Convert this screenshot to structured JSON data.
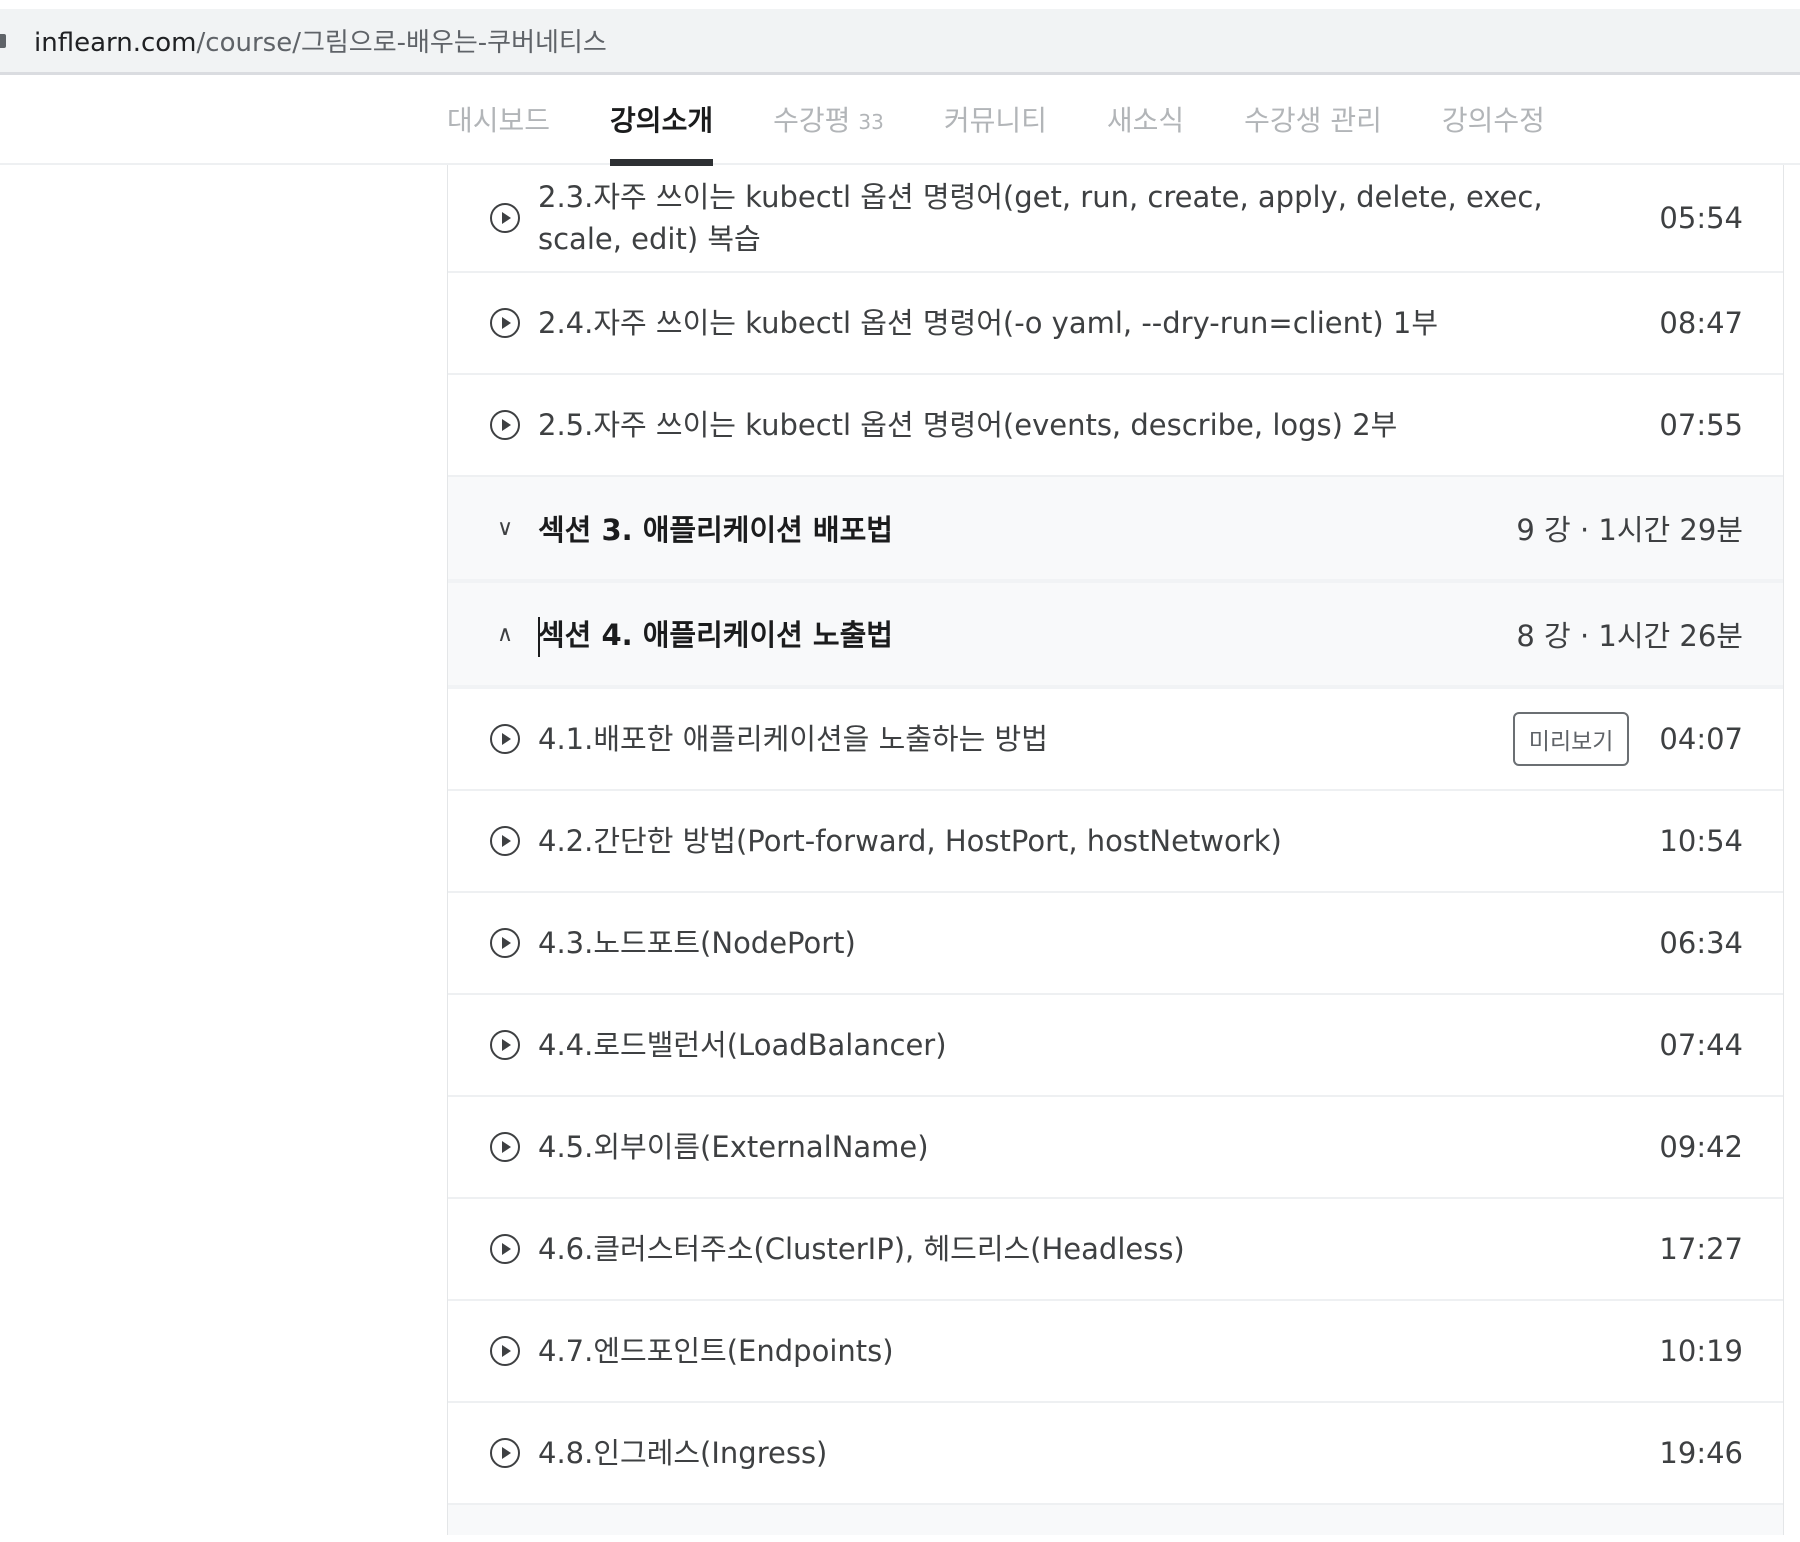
{
  "browser": {
    "url_host": "inflearn.com",
    "url_path": "/course/그림으로-배우는-쿠버네티스"
  },
  "tabs": [
    {
      "label": "대시보드"
    },
    {
      "label": "강의소개",
      "active": true
    },
    {
      "label": "수강평",
      "count": "33"
    },
    {
      "label": "커뮤니티"
    },
    {
      "label": "새소식"
    },
    {
      "label": "수강생 관리"
    },
    {
      "label": "강의수정"
    }
  ],
  "lessons_top": [
    {
      "title": "2.3.자주 쓰이는 kubectl 옵션 명령어(get, run, create, apply, delete, exec, scale, edit) 복습",
      "time": "05:54"
    },
    {
      "title": "2.4.자주 쓰이는 kubectl 옵션 명령어(-o yaml, --dry-run=client) 1부",
      "time": "08:47"
    },
    {
      "title": "2.5.자주 쓰이는 kubectl 옵션 명령어(events, describe, logs) 2부",
      "time": "07:55"
    }
  ],
  "sections": [
    {
      "title": "섹션 3. 애플리케이션 배포법",
      "meta": "9 강 · 1시간 29분",
      "expanded": false
    },
    {
      "title": "섹션 4. 애플리케이션 노출법",
      "meta": "8 강 · 1시간 26분",
      "expanded": true
    }
  ],
  "preview_label": "미리보기",
  "lessons_s4": [
    {
      "title": "4.1.배포한 애플리케이션을 노출하는 방법",
      "time": "04:07"
    },
    {
      "title": "4.2.간단한 방법(Port-forward, HostPort, hostNetwork)",
      "time": "10:54"
    },
    {
      "title": "4.3.노드포트(NodePort)",
      "time": "06:34"
    },
    {
      "title": "4.4.로드밸런서(LoadBalancer)",
      "time": "07:44"
    },
    {
      "title": "4.5.외부이름(ExternalName)",
      "time": "09:42"
    },
    {
      "title": "4.6.클러스터주소(ClusterIP), 헤드리스(Headless)",
      "time": "17:27"
    },
    {
      "title": "4.7.엔드포인트(Endpoints)",
      "time": "10:19"
    },
    {
      "title": "4.8.인그레스(Ingress)",
      "time": "19:46"
    }
  ]
}
